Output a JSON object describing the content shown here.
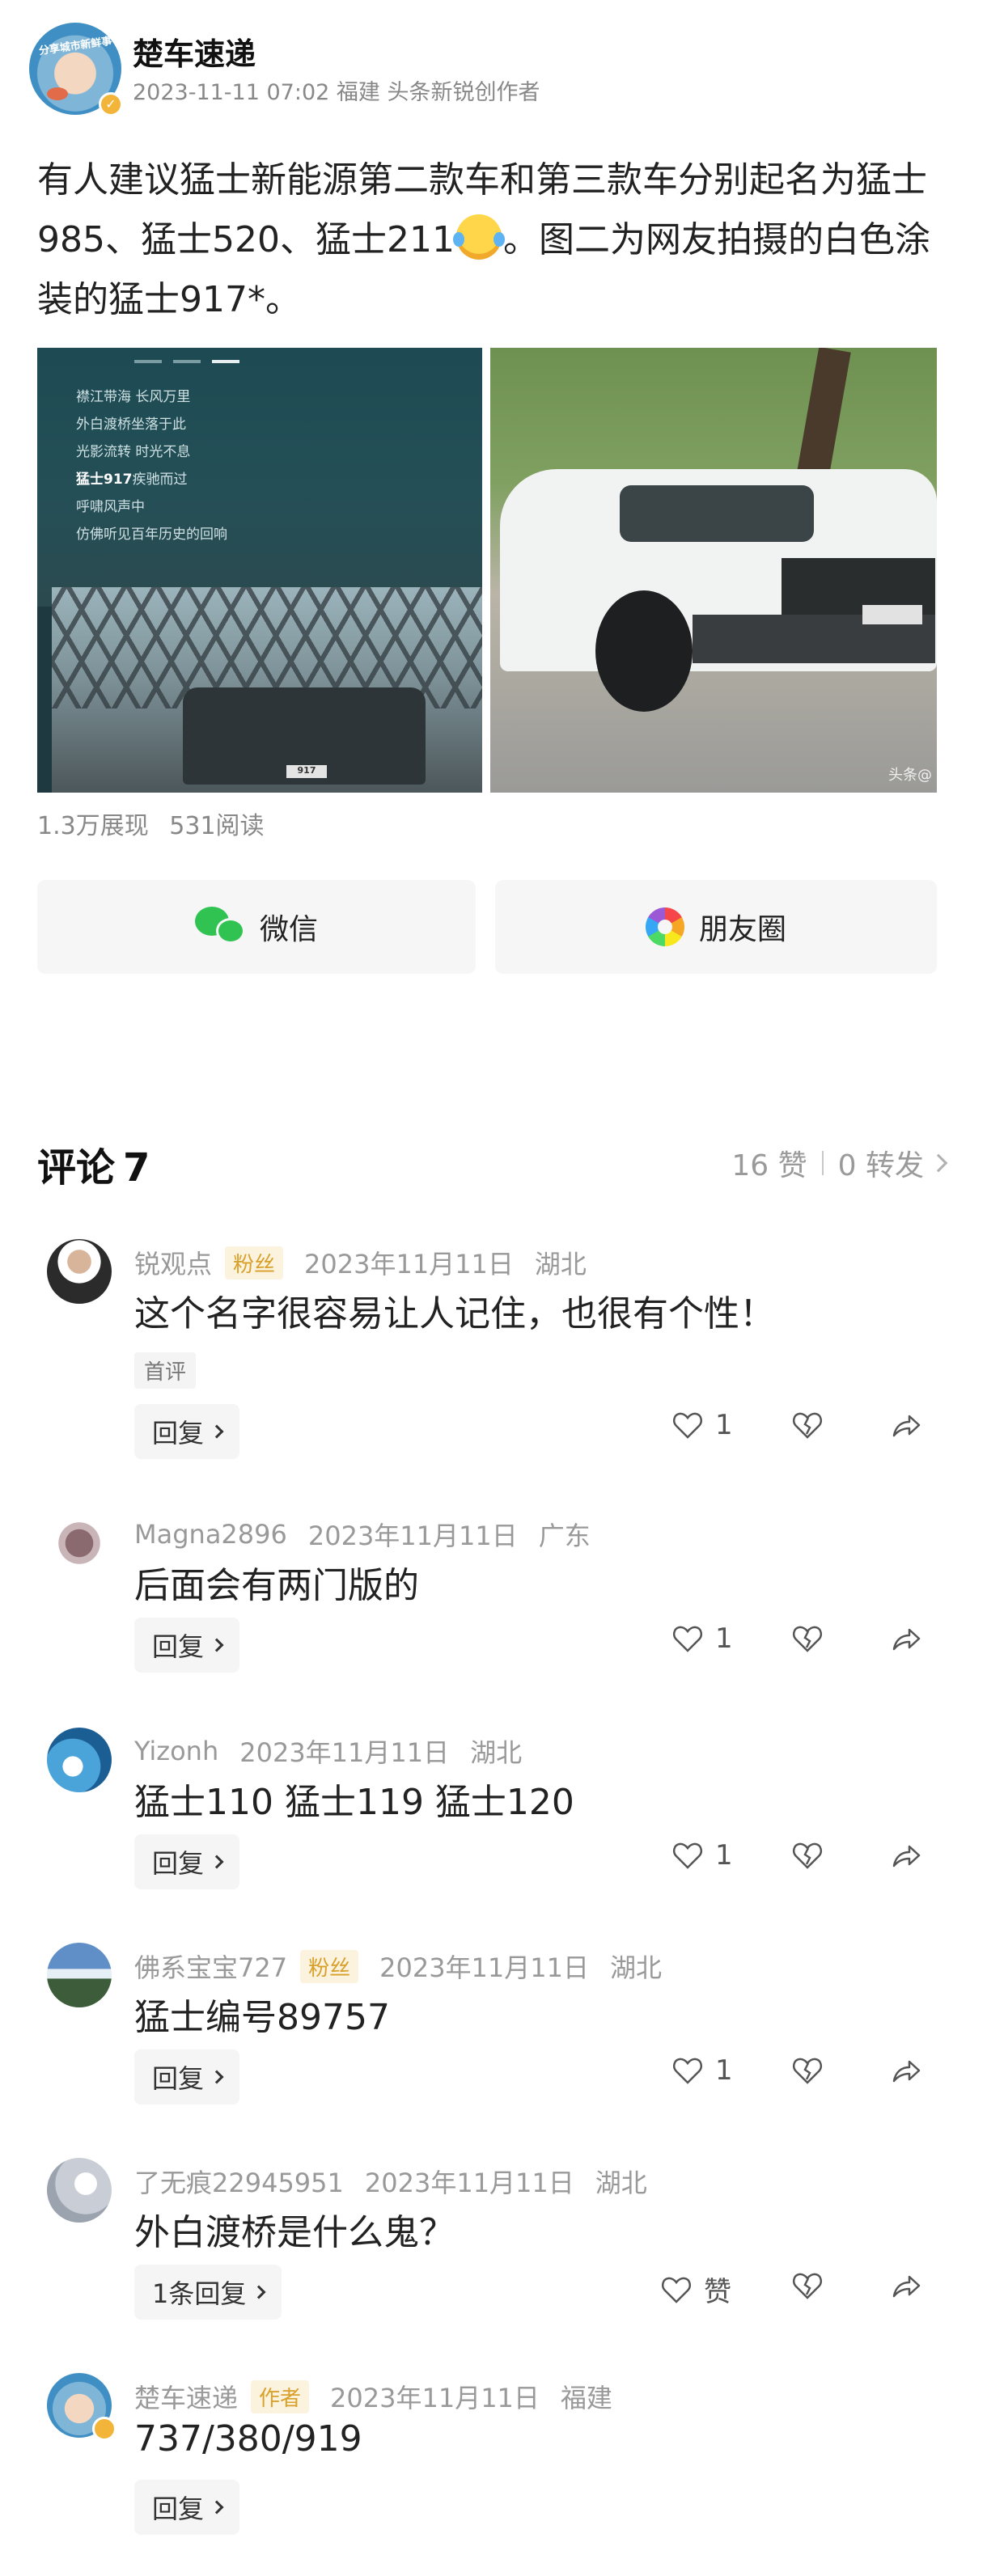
{
  "author": {
    "name": "楚车速递",
    "avatar_text": "分享城市新鲜事",
    "meta": "2023-11-11 07:02  福建  头条新锐创作者"
  },
  "article": {
    "text_part1": "有人建议猛士新能源第二款车和第三款车分别起名为猛士985、猛士520、猛士211",
    "text_part2": "。图二为网友拍摄的白色涂装的猛士917*。"
  },
  "images": {
    "poem_lines": [
      "襟江带海 长风万里",
      "外白渡桥坐落于此",
      "光影流转 时光不息"
    ],
    "poem_bold": "猛士917",
    "poem_bold_suffix": "疾驰而过",
    "poem_lines2": [
      "呼啸风声中",
      "仿佛听见百年历史的回响"
    ],
    "plate_text": "917",
    "watermark": "头条@"
  },
  "stats": {
    "impressions": "1.3万展现",
    "reads": "531阅读"
  },
  "share": {
    "wechat": "微信",
    "moments": "朋友圈"
  },
  "comments_header": {
    "title": "评论",
    "count": "7",
    "likes": "16 赞",
    "reposts": "0 转发"
  },
  "comments": [
    {
      "user": "锐观点",
      "badge": "粉丝",
      "date": "2023年11月11日",
      "location": "湖北",
      "text": "这个名字很容易让人记住，也很有个性！",
      "tag": "首评",
      "reply": "回复",
      "likes": "1"
    },
    {
      "user": "Magna2896",
      "date": "2023年11月11日",
      "location": "广东",
      "text": "后面会有两门版的",
      "reply": "回复",
      "likes": "1"
    },
    {
      "user": "Yizonh",
      "date": "2023年11月11日",
      "location": "湖北",
      "text": "猛士110 猛士119 猛士120",
      "reply": "回复",
      "likes": "1"
    },
    {
      "user": "佛系宝宝727",
      "badge": "粉丝",
      "date": "2023年11月11日",
      "location": "湖北",
      "text": "猛士编号89757",
      "reply": "回复",
      "likes": "1"
    },
    {
      "user": "了无痕22945951",
      "date": "2023年11月11日",
      "location": "湖北",
      "text": "外白渡桥是什么鬼？",
      "reply": "1条回复",
      "likes": "赞"
    },
    {
      "user": "楚车速递",
      "badge": "作者",
      "date": "2023年11月11日",
      "location": "福建",
      "text": "737/380/919",
      "reply": "回复"
    }
  ],
  "colors": {
    "wechat_green": "#31c352",
    "badge_gold": "#d9a02b",
    "muted_gray": "#999999"
  }
}
